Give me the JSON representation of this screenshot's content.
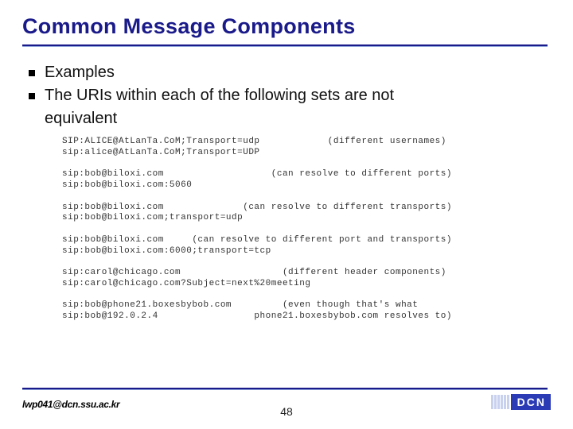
{
  "title": "Common Message Components",
  "bullets": {
    "b1": "Examples",
    "b2": "The URIs within each of the following sets are not",
    "b2_cont": "equivalent"
  },
  "code": "SIP:ALICE@AtLanTa.CoM;Transport=udp            (different usernames)\nsip:alice@AtLanTa.CoM;Transport=UDP\n\nsip:bob@biloxi.com                   (can resolve to different ports)\nsip:bob@biloxi.com:5060\n\nsip:bob@biloxi.com              (can resolve to different transports)\nsip:bob@biloxi.com;transport=udp\n\nsip:bob@biloxi.com     (can resolve to different port and transports)\nsip:bob@biloxi.com:6000;transport=tcp\n\nsip:carol@chicago.com                  (different header components)\nsip:carol@chicago.com?Subject=next%20meeting\n\nsip:bob@phone21.boxesbybob.com         (even though that's what\nsip:bob@192.0.2.4                 phone21.boxesbybob.com resolves to)",
  "footer": {
    "email": "lwp041@dcn.ssu.ac.kr",
    "page": "48",
    "logo": "DCN"
  }
}
